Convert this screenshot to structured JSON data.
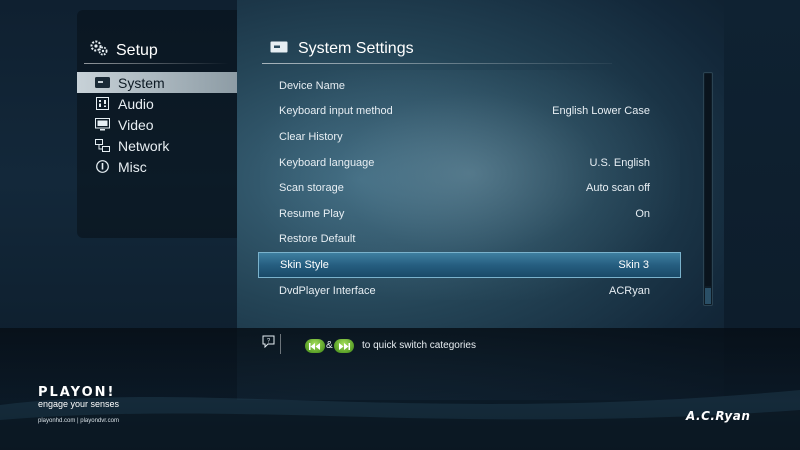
{
  "setup": {
    "title": "Setup",
    "icon": "gears-icon",
    "categories": [
      {
        "label": "System",
        "icon": "system-icon",
        "selected": true
      },
      {
        "label": "Audio",
        "icon": "audio-icon",
        "selected": false
      },
      {
        "label": "Video",
        "icon": "video-icon",
        "selected": false
      },
      {
        "label": "Network",
        "icon": "network-icon",
        "selected": false
      },
      {
        "label": "Misc",
        "icon": "info-icon",
        "selected": false
      }
    ]
  },
  "main": {
    "title": "System Settings",
    "icon": "system-icon",
    "rows": [
      {
        "label": "Device Name",
        "value": ""
      },
      {
        "label": "Keyboard input method",
        "value": "English Lower Case"
      },
      {
        "label": "Clear History",
        "value": ""
      },
      {
        "label": "Keyboard language",
        "value": "U.S. English"
      },
      {
        "label": "Scan storage",
        "value": "Auto scan off"
      },
      {
        "label": "Resume Play",
        "value": "On"
      },
      {
        "label": "Restore Default",
        "value": ""
      },
      {
        "label": "Skin Style",
        "value": "Skin 3",
        "selected": true
      },
      {
        "label": "DvdPlayer Interface",
        "value": "ACRyan"
      }
    ]
  },
  "help": {
    "icon": "help-icon",
    "prev_icon": "previous-track-icon",
    "next_icon": "next-track-icon",
    "ampersand": "&",
    "hint": "to quick switch categories"
  },
  "footer": {
    "brand": "PLAYON!",
    "tagline": "engage your senses",
    "sites": "playonhd.com  |  playondvr.com",
    "maker": "A.C.Ryan"
  },
  "colors": {
    "selected_row": "#265e80",
    "selected_category": "#c8d2d8",
    "accent_button": "#5aa028"
  }
}
